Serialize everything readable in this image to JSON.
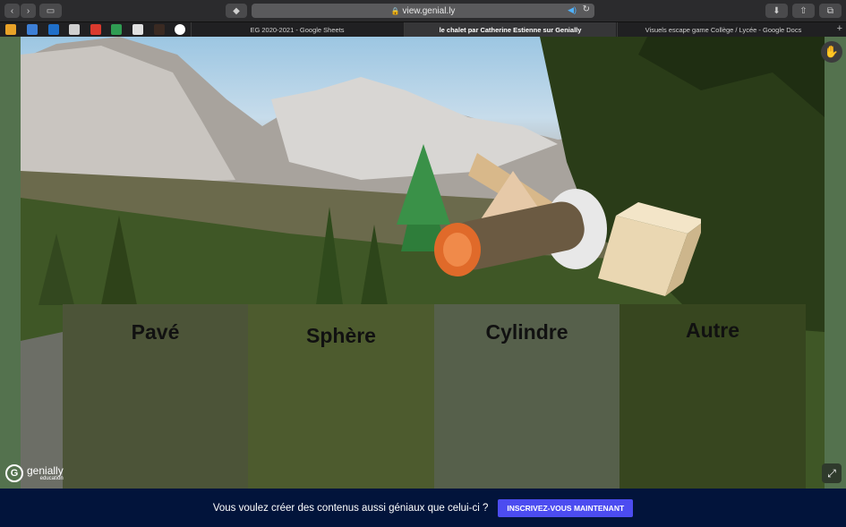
{
  "browser": {
    "url": "view.genial.ly",
    "tabs": [
      {
        "title": "EG 2020-2021 - Google Sheets",
        "active": false
      },
      {
        "title": "le chalet par Catherine Estienne sur Genially",
        "active": true
      },
      {
        "title": "Visuels escape game Collège / Lycée - Google Docs",
        "active": false
      }
    ],
    "nav_icons": [
      "back-icon",
      "forward-icon",
      "sidebar-icon",
      "tag-icon"
    ],
    "action_icons": [
      "download-icon",
      "share-icon",
      "tabs-overview-icon"
    ],
    "bookmark_icons": [
      "bookmark-b-icon",
      "bookmark-bird-icon",
      "bookmark-outlook-icon",
      "bookmark-px-icon",
      "bookmark-gmail-icon",
      "bookmark-drive-icon",
      "bookmark-page-icon",
      "bookmark-dark-icon",
      "bookmark-google-icon"
    ]
  },
  "genially": {
    "categories": [
      {
        "label": "Pavé"
      },
      {
        "label": "Sphère"
      },
      {
        "label": "Cylindre"
      },
      {
        "label": "Autre"
      }
    ],
    "logo": {
      "brand": "genially",
      "sub": "education"
    }
  },
  "banner": {
    "message": "Vous voulez créer des contenus aussi géniaux que celui-ci ?",
    "cta": "INSCRIVEZ-VOUS MAINTENANT"
  },
  "colors": {
    "banner_bg": "#02143b",
    "cta_bg": "#4c4cf0",
    "stage_border": "#54724e"
  }
}
